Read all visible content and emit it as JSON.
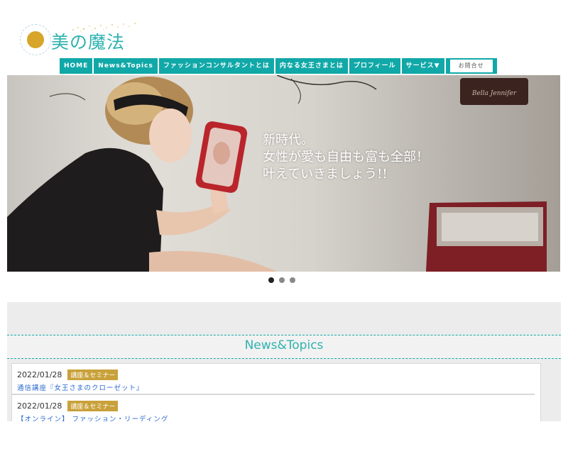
{
  "logo": {
    "text": "美の魔法"
  },
  "nav": {
    "items": [
      "HOME",
      "News&Topics",
      "ファッションコンサルタントとは",
      "内なる女王さまとは",
      "プロフィール",
      "サービス▼"
    ],
    "contact": "お問合せ"
  },
  "hero": {
    "line1": "新時代。",
    "line2": "女性が愛も自由も富も全部！",
    "line3": "叶えていきましょう!!",
    "sign": "Bella Jennifer"
  },
  "slider": {
    "count": 3,
    "active": 1
  },
  "news": {
    "title": "News&Topics",
    "items": [
      {
        "date": "2022/01/28",
        "tag": "講座＆セミナー",
        "title": "通信講座『女王さまのクローゼット』"
      },
      {
        "date": "2022/01/28",
        "tag": "講座＆セミナー",
        "title": "【オンライン】 ファッション・リーディング"
      }
    ]
  },
  "colors": {
    "teal": "#11a8a8",
    "gold": "#c9a13a",
    "link": "#2a6ad1"
  }
}
